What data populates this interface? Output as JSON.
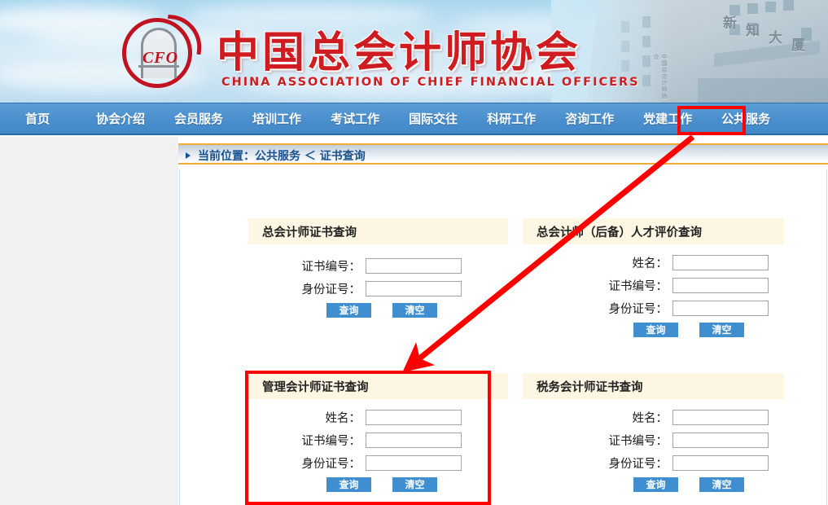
{
  "header": {
    "org_title": "中国总会计师协会",
    "org_subtitle": "CHINA ASSOCIATION OF CHIEF FINANCIAL OFFICERS",
    "logo_text": "CFO",
    "building_text_1": "新",
    "building_text_2": "知",
    "building_text_3": "大",
    "building_text_4": "厦",
    "building_vertical_text": "中国总会计师协会"
  },
  "nav": {
    "items": [
      {
        "label": "首页",
        "highlighted": false
      },
      {
        "label": "协会介绍",
        "highlighted": false
      },
      {
        "label": "会员服务",
        "highlighted": false
      },
      {
        "label": "培训工作",
        "highlighted": false
      },
      {
        "label": "考试工作",
        "highlighted": false
      },
      {
        "label": "国际交往",
        "highlighted": false
      },
      {
        "label": "科研工作",
        "highlighted": false
      },
      {
        "label": "咨询工作",
        "highlighted": false
      },
      {
        "label": "党建工作",
        "highlighted": false
      },
      {
        "label": "公共服务",
        "highlighted": true
      }
    ]
  },
  "breadcrumb": {
    "text": "当前位置：公共服务 ＜ 证书查询"
  },
  "buttons": {
    "submit_label": "查询",
    "clear_label": "清空"
  },
  "cards": [
    {
      "title": "总会计师证书查询",
      "highlighted": false,
      "fields": [
        {
          "label": "证书编号：",
          "value": "",
          "placeholder": ""
        },
        {
          "label": "身份证号：",
          "value": "",
          "placeholder": ""
        }
      ]
    },
    {
      "title": "总会计师（后备）人才评价查询",
      "highlighted": false,
      "fields": [
        {
          "label": "姓名：",
          "value": "",
          "placeholder": ""
        },
        {
          "label": "证书编号：",
          "value": "",
          "placeholder": ""
        },
        {
          "label": "身份证号：",
          "value": "",
          "placeholder": ""
        }
      ]
    },
    {
      "title": "管理会计师证书查询",
      "highlighted": true,
      "fields": [
        {
          "label": "姓名：",
          "value": "",
          "placeholder": ""
        },
        {
          "label": "证书编号：",
          "value": "",
          "placeholder": ""
        },
        {
          "label": "身份证号：",
          "value": "",
          "placeholder": ""
        }
      ]
    },
    {
      "title": "税务会计师证书查询",
      "highlighted": false,
      "fields": [
        {
          "label": "姓名：",
          "value": "",
          "placeholder": ""
        },
        {
          "label": "证书编号：",
          "value": "",
          "placeholder": ""
        },
        {
          "label": "身份证号：",
          "value": "",
          "placeholder": ""
        }
      ]
    }
  ],
  "annotations": {
    "arrow_color": "#ff0000",
    "highlight_color": "#ff0000",
    "arrow_from_label": "公共服务",
    "arrow_to_label": "管理会计师证书查询"
  },
  "colors": {
    "nav_blue": "#4a90ce",
    "button_blue": "#3e8ed0",
    "card_header_cream": "#fdf6e2",
    "breadcrumb_orange": "#f0ad33",
    "brand_red": "#cf1c20",
    "left_pane_gray": "#f1f1f1"
  }
}
